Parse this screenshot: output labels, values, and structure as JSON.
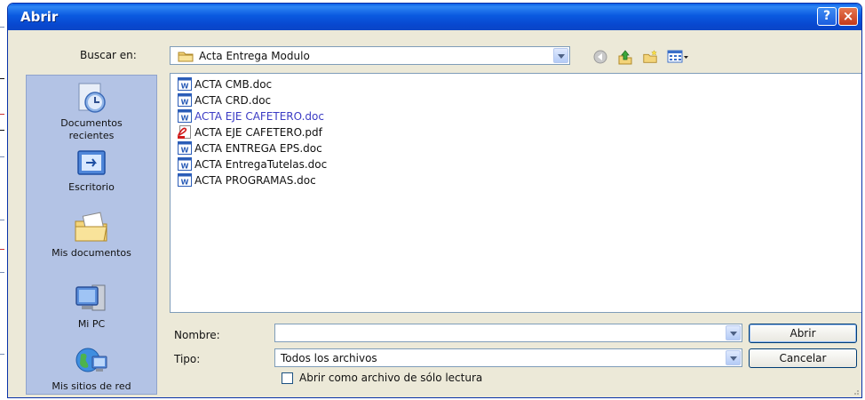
{
  "window": {
    "title": "Abrir",
    "help_glyph": "?",
    "close_glyph": "×"
  },
  "look_in": {
    "label": "Buscar en:",
    "value": "Acta Entrega Modulo"
  },
  "toolbar": {
    "icons": [
      "back-icon",
      "up-folder-icon",
      "new-folder-icon",
      "views-menu-icon"
    ]
  },
  "places": [
    {
      "id": "recent",
      "label_lines": [
        "Documentos",
        "recientes"
      ],
      "icon": "recent-documents-icon"
    },
    {
      "id": "desktop",
      "label_lines": [
        "Escritorio"
      ],
      "icon": "desktop-icon"
    },
    {
      "id": "documents",
      "label_lines": [
        "Mis documentos"
      ],
      "icon": "my-documents-icon"
    },
    {
      "id": "computer",
      "label_lines": [
        "Mi PC"
      ],
      "icon": "my-computer-icon"
    },
    {
      "id": "network",
      "label_lines": [
        "Mis sitios de red"
      ],
      "icon": "network-places-icon"
    }
  ],
  "files": [
    {
      "name": "ACTA CMB.doc",
      "type": "doc"
    },
    {
      "name": "ACTA CRD.doc",
      "type": "doc"
    },
    {
      "name": "ACTA EJE CAFETERO.doc",
      "type": "doc",
      "highlighted": true
    },
    {
      "name": "ACTA EJE CAFETERO.pdf",
      "type": "pdf"
    },
    {
      "name": "ACTA ENTREGA EPS.doc",
      "type": "doc"
    },
    {
      "name": "ACTA EntregaTutelas.doc",
      "type": "doc"
    },
    {
      "name": "ACTA PROGRAMAS.doc",
      "type": "doc"
    }
  ],
  "filename": {
    "label": "Nombre:",
    "value": ""
  },
  "filetype": {
    "label": "Tipo:",
    "value": "Todos los archivos"
  },
  "readonly": {
    "label": "Abrir como archivo de sólo lectura",
    "checked": false
  },
  "buttons": {
    "open": "Abrir",
    "cancel": "Cancelar"
  }
}
